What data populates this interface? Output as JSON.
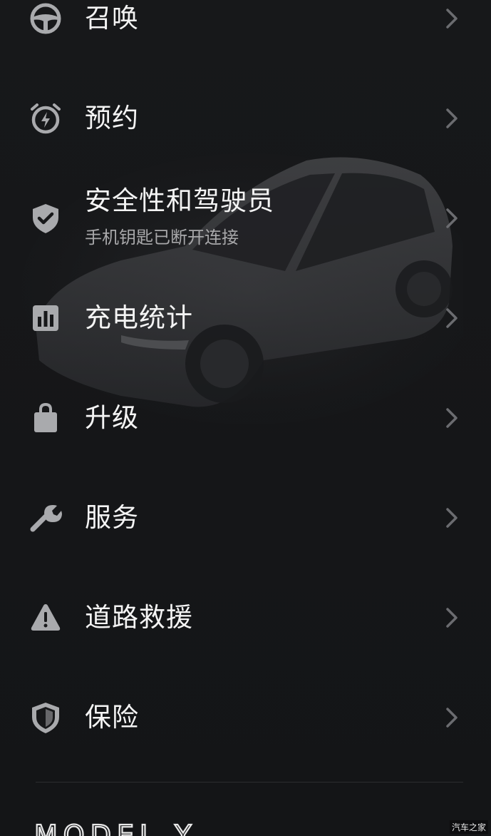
{
  "menu": {
    "items": [
      {
        "label": "召唤",
        "icon": "steering-wheel-icon"
      },
      {
        "label": "预约",
        "icon": "alarm-clock-bolt-icon"
      },
      {
        "label": "安全性和驾驶员",
        "sub": "手机钥匙已断开连接",
        "icon": "shield-check-icon"
      },
      {
        "label": "充电统计",
        "icon": "bar-chart-icon"
      },
      {
        "label": "升级",
        "icon": "shopping-bag-icon"
      },
      {
        "label": "服务",
        "icon": "wrench-icon"
      },
      {
        "label": "道路救援",
        "icon": "warning-triangle-icon"
      },
      {
        "label": "保险",
        "icon": "shield-outline-icon"
      }
    ]
  },
  "footer": {
    "model_name": "MODEL Y"
  },
  "watermark": "汽车之家",
  "colors": {
    "background": "#161719",
    "text": "#f4f4f4",
    "subtext": "#a8a8aa",
    "icon": "#a9aaad",
    "chevron": "#6b6c70"
  }
}
